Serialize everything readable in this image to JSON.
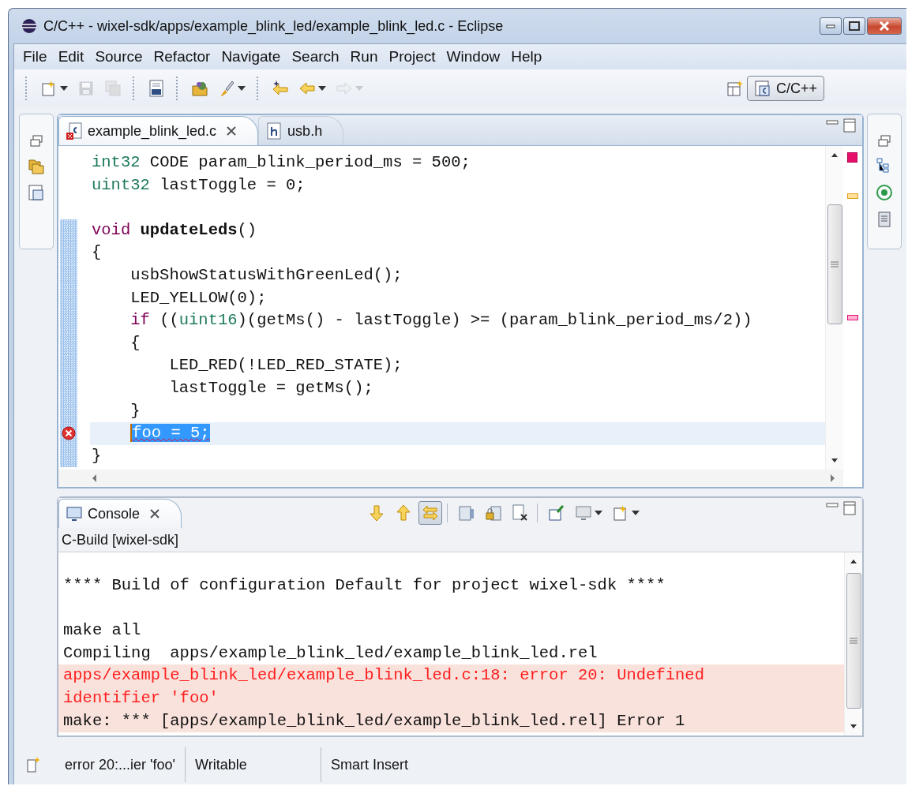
{
  "window": {
    "title": "C/C++ - wixel-sdk/apps/example_blink_led/example_blink_led.c - Eclipse"
  },
  "menu": [
    "File",
    "Edit",
    "Source",
    "Refactor",
    "Navigate",
    "Search",
    "Run",
    "Project",
    "Window",
    "Help"
  ],
  "toolbar": [
    {
      "kind": "new",
      "dropdown": true,
      "disabled": false
    },
    {
      "kind": "save",
      "dropdown": false,
      "disabled": true
    },
    {
      "kind": "save-all",
      "dropdown": false,
      "disabled": true
    },
    {
      "kind": "sep"
    },
    {
      "kind": "binary",
      "dropdown": false,
      "disabled": false
    },
    {
      "kind": "sep"
    },
    {
      "kind": "open-folder",
      "dropdown": false,
      "disabled": false
    },
    {
      "kind": "brush",
      "dropdown": true,
      "disabled": false
    },
    {
      "kind": "sep"
    },
    {
      "kind": "back-star",
      "dropdown": false,
      "disabled": false
    },
    {
      "kind": "back",
      "dropdown": true,
      "disabled": false
    },
    {
      "kind": "forward",
      "dropdown": true,
      "disabled": true
    }
  ],
  "perspective": {
    "label": "C/C++",
    "selected": true
  },
  "editor": {
    "tabs": [
      {
        "label": "example_blink_led.c",
        "kind": "c-error",
        "selected": true
      },
      {
        "label": "usb.h",
        "kind": "h",
        "selected": false
      }
    ],
    "lines": [
      {
        "changed": false,
        "error": false,
        "current": false,
        "tokens": [
          {
            "t": "int32",
            "kind": "type"
          },
          {
            "t": " CODE param_blink_period_ms = 500;",
            "kind": "plain"
          }
        ]
      },
      {
        "changed": false,
        "error": false,
        "current": false,
        "tokens": [
          {
            "t": "uint32",
            "kind": "type"
          },
          {
            "t": " lastToggle = 0;",
            "kind": "plain"
          }
        ]
      },
      {
        "changed": false,
        "error": false,
        "current": false
      },
      {
        "changed": true,
        "error": false,
        "current": false,
        "tokens": [
          {
            "t": "void",
            "kind": "keyword"
          },
          {
            "t": " updateLeds",
            "kind": "bold"
          },
          {
            "t": "()",
            "kind": "plain"
          }
        ]
      },
      {
        "changed": true,
        "error": false,
        "current": false,
        "tokens": [
          {
            "t": "{",
            "kind": "plain"
          }
        ]
      },
      {
        "changed": true,
        "error": false,
        "current": false,
        "tokens": [
          {
            "t": "    usbShowStatusWithGreenLed();",
            "kind": "plain"
          }
        ]
      },
      {
        "changed": true,
        "error": false,
        "current": false,
        "tokens": [
          {
            "t": "    LED_YELLOW(0);",
            "kind": "plain"
          }
        ]
      },
      {
        "changed": true,
        "error": false,
        "current": false,
        "tokens": [
          {
            "t": "    if",
            "kind": "keyword"
          },
          {
            "t": " ((",
            "kind": "plain"
          },
          {
            "t": "uint16",
            "kind": "type"
          },
          {
            "t": ")(getMs() - lastToggle) >= (param_blink_period_ms/2))",
            "kind": "plain"
          }
        ]
      },
      {
        "changed": true,
        "error": false,
        "current": false,
        "tokens": [
          {
            "t": "    {",
            "kind": "plain"
          }
        ]
      },
      {
        "changed": true,
        "error": false,
        "current": false,
        "tokens": [
          {
            "t": "        LED_RED(!LED_RED_STATE);",
            "kind": "plain"
          }
        ]
      },
      {
        "changed": true,
        "error": false,
        "current": false,
        "tokens": [
          {
            "t": "        lastToggle = getMs();",
            "kind": "plain"
          }
        ]
      },
      {
        "changed": true,
        "error": false,
        "current": false,
        "tokens": [
          {
            "t": "    }",
            "kind": "plain"
          }
        ]
      },
      {
        "changed": true,
        "error": true,
        "current": true,
        "tokens": [
          {
            "t": "    foo = 5;",
            "kind": "selected"
          }
        ]
      },
      {
        "changed": true,
        "error": false,
        "current": false,
        "tokens": [
          {
            "t": "}",
            "kind": "plain"
          }
        ]
      }
    ]
  },
  "console": {
    "tab": {
      "label": "Console",
      "selected": true
    },
    "toolbar": [
      {
        "kind": "down",
        "toggled": false
      },
      {
        "kind": "up",
        "toggled": false
      },
      {
        "kind": "swap",
        "toggled": true
      },
      {
        "kind": "sep"
      },
      {
        "kind": "doc",
        "toggled": false
      },
      {
        "kind": "lock",
        "toggled": false
      },
      {
        "kind": "remove",
        "toggled": false
      },
      {
        "kind": "sep"
      },
      {
        "kind": "pin",
        "toggled": false
      },
      {
        "kind": "monitor",
        "toggled": false
      },
      {
        "kind": "new",
        "toggled": false
      }
    ],
    "subtitle": "C-Build [wixel-sdk]",
    "groups": [
      [
        {
          "text": "**** Build of configuration Default for project wixel-sdk ****",
          "kind": "out"
        }
      ],
      [
        {
          "text": "make all",
          "kind": "out"
        },
        {
          "text": "Compiling  apps/example_blink_led/example_blink_led.rel",
          "kind": "out"
        },
        {
          "text": "apps/example_blink_led/example_blink_led.c:18: error 20: Undefined",
          "kind": "error"
        },
        {
          "text": "identifier 'foo'",
          "kind": "error"
        },
        {
          "text": "make: *** [apps/example_blink_led/example_blink_led.rel] Error 1",
          "kind": "stderr"
        }
      ]
    ]
  },
  "status_bar": [
    "error 20:...ier 'foo'",
    "Writable",
    "Smart Insert"
  ]
}
